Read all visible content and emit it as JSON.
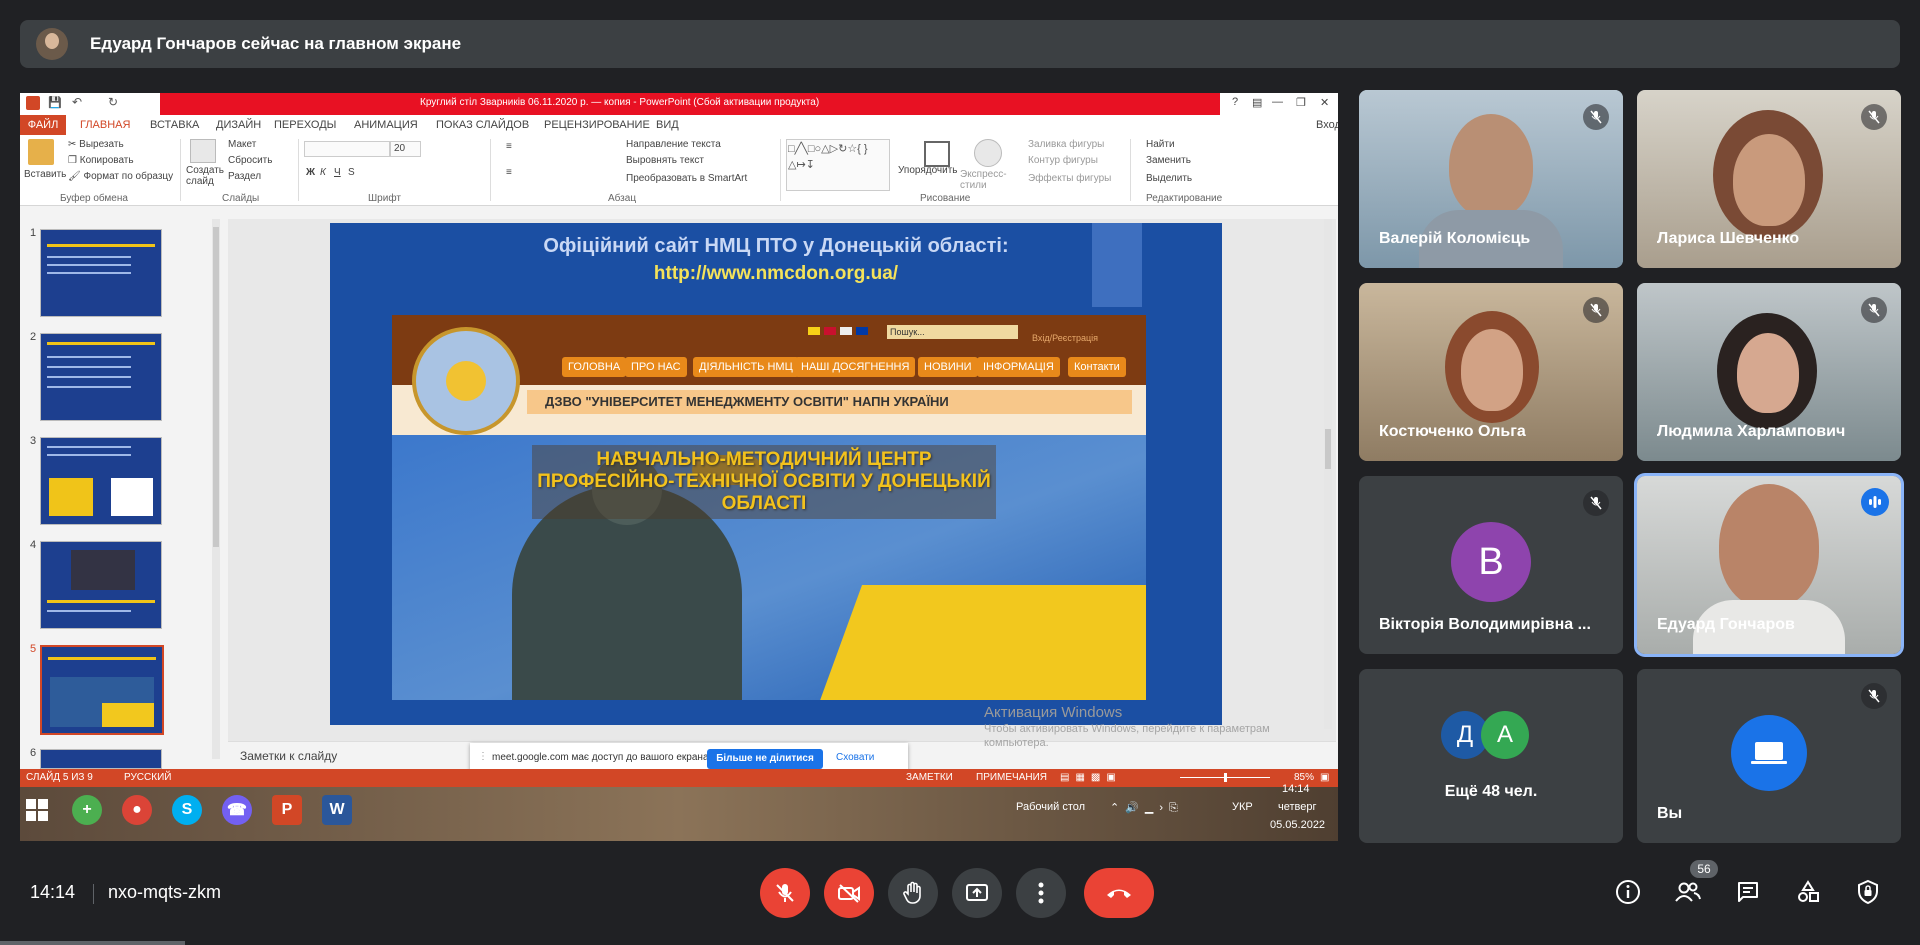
{
  "banner": {
    "text": "Едуард Гончаров сейчас на главном экране"
  },
  "powerpoint": {
    "title": "Круглий стіл Зварників 06.11.2020 р. — копия - PowerPoint (Сбой активации продукта)",
    "login": "Вход",
    "menu": [
      "ФАЙЛ",
      "ГЛАВНАЯ",
      "ВСТАВКА",
      "ДИЗАЙН",
      "ПЕРЕХОДЫ",
      "АНИМАЦИЯ",
      "ПОКАЗ СЛАЙДОВ",
      "РЕЦЕНЗИРОВАНИЕ",
      "ВИД"
    ],
    "ribbon": {
      "paste": "Вставить",
      "cut": "Вырезать",
      "copy": "Копировать",
      "format_painter": "Формат по образцу",
      "new_slide": "Создать слайд",
      "layout": "Макет",
      "reset": "Сбросить",
      "section": "Раздел",
      "font_size": "20",
      "text_direction": "Направление текста",
      "align_text": "Выровнять текст",
      "convert_smartart": "Преобразовать в SmartArt",
      "arrange": "Упорядочить",
      "quick_styles": "Экспресс-стили",
      "shape_fill": "Заливка фигуры",
      "shape_outline": "Контур фигуры",
      "shape_effects": "Эффекты фигуры",
      "find": "Найти",
      "replace": "Заменить",
      "select": "Выделить",
      "groups": [
        "Буфер обмена",
        "Слайды",
        "Шрифт",
        "Абзац",
        "Рисование",
        "Редактирование"
      ]
    },
    "slide_numbers": [
      "1",
      "2",
      "3",
      "4",
      "5",
      "6"
    ],
    "slide": {
      "title_line1": "Офіційний сайт НМЦ ПТО у Донецькій області:",
      "title_line2": "http://www.nmcdon.org.ua/",
      "search_placeholder": "Пошук...",
      "login_link": "Вхід/Реєстрація",
      "nav": [
        "ГОЛОВНА",
        "ПРО НАС",
        "ДІЯЛЬНІСТЬ НМЦ",
        "НАШІ ДОСЯГНЕННЯ",
        "НОВИНИ",
        "ІНФОРМАЦІЯ",
        "Контакти"
      ],
      "dzvo": "ДЗВО \"УНІВЕРСИТЕТ МЕНЕДЖМЕНТУ ОСВІТИ\" НАПН УКРАЇНИ",
      "headline": "НАВЧАЛЬНО-МЕТОДИЧНИЙ ЦЕНТР ПРОФЕСІЙНО-ТЕХНІЧНОЇ ОСВІТИ У ДОНЕЦЬКІЙ ОБЛАСТІ"
    },
    "notes": "Заметки к слайду",
    "activation": {
      "title": "Активация Windows",
      "line1": "Чтобы активировать Windows, перейдите к параметрам",
      "line2": "компьютера."
    },
    "share_bar": {
      "text": "meet.google.com має доступ до вашого екрана.",
      "stop": "Більше не ділитися",
      "hide": "Сховати"
    },
    "status": {
      "slide": "СЛАЙД 5 ИЗ 9",
      "lang": "РУССКИЙ",
      "notes": "ЗАМЕТКИ",
      "comments": "ПРИМЕЧАНИЯ",
      "zoom": "85%"
    },
    "taskbar": {
      "desktop": "Рабочий стол",
      "lang": "УКР",
      "time": "14:14",
      "day": "четверг",
      "date": "05.05.2022"
    }
  },
  "participants": [
    {
      "name": "Валерій Коломієць",
      "muted": true
    },
    {
      "name": "Лариса Шевченко",
      "muted": true
    },
    {
      "name": "Костюченко Ольга",
      "muted": true
    },
    {
      "name": "Людмила Харлампович",
      "muted": true
    },
    {
      "name": "Вікторія Володимирівна ...",
      "muted": true,
      "initial": "В"
    },
    {
      "name": "Едуард Гончаров",
      "muted": false,
      "speaking": true
    },
    {
      "more": "Ещё 48 чел.",
      "initials": [
        "Д",
        "А"
      ]
    },
    {
      "name": "Вы",
      "muted": true
    }
  ],
  "meeting": {
    "time": "14:14",
    "code": "nxo-mqts-zkm",
    "participant_count": "56"
  },
  "colors": {
    "bg": "#202124",
    "tile": "#3c4043",
    "red": "#ea4335",
    "blue": "#1a73e8",
    "ppt": "#d24726"
  }
}
